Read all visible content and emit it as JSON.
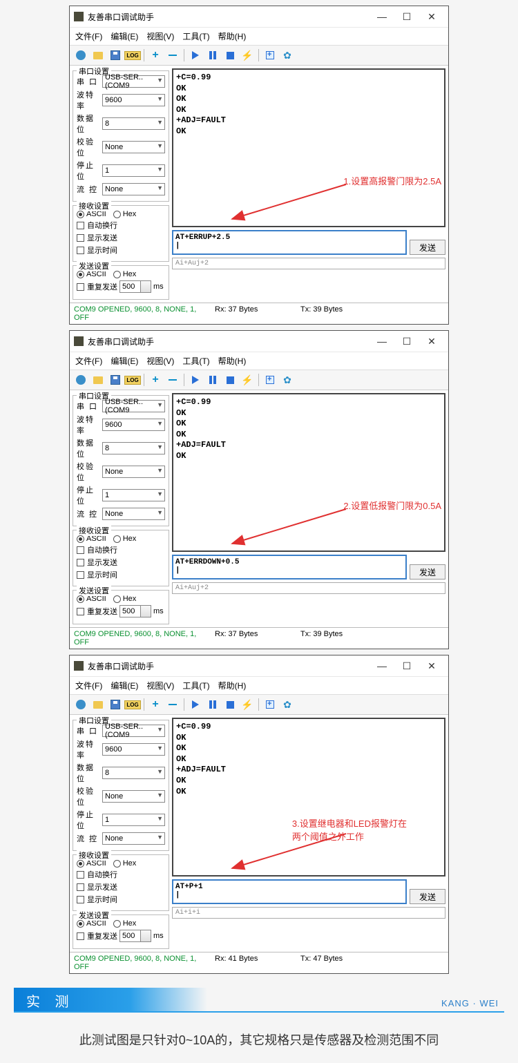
{
  "windows": [
    {
      "title": "友善串口调试助手",
      "menu": [
        "文件(F)",
        "编辑(E)",
        "视图(V)",
        "工具(T)",
        "帮助(H)"
      ],
      "serial": {
        "group": "串口设置",
        "port_label": "串  口",
        "port": "USB-SER..(COM9",
        "baud_label": "波特率",
        "baud": "9600",
        "data_label": "数据位",
        "data": "8",
        "parity_label": "校验位",
        "parity": "None",
        "stop_label": "停止位",
        "stop": "1",
        "flow_label": "流  控",
        "flow": "None"
      },
      "rx_settings": {
        "group": "接收设置",
        "ascii": "ASCII",
        "hex": "Hex",
        "auto_wrap": "自动换行",
        "show_send": "显示发送",
        "show_time": "显示时间"
      },
      "tx_settings": {
        "group": "发送设置",
        "ascii": "ASCII",
        "hex": "Hex",
        "repeat": "重复发送",
        "interval": "500",
        "unit": "ms"
      },
      "rx_text": "+C=0.99\nOK\nOK\nOK\n+ADJ=FAULT\nOK",
      "tx_text": "AT+ERRUP+2.5\n|",
      "hist": "Ai+Auj+2",
      "send_label": "发送",
      "status": {
        "left": "COM9 OPENED, 9600, 8, NONE, 1, OFF",
        "rx": "Rx: 37 Bytes",
        "tx": "Tx: 39 Bytes"
      },
      "annotation": "1.设置高报警门限为2.5A"
    },
    {
      "title": "友善串口调试助手",
      "menu": [
        "文件(F)",
        "编辑(E)",
        "视图(V)",
        "工具(T)",
        "帮助(H)"
      ],
      "serial": {
        "group": "串口设置",
        "port_label": "串  口",
        "port": "USB-SER..(COM9",
        "baud_label": "波特率",
        "baud": "9600",
        "data_label": "数据位",
        "data": "8",
        "parity_label": "校验位",
        "parity": "None",
        "stop_label": "停止位",
        "stop": "1",
        "flow_label": "流  控",
        "flow": "None"
      },
      "rx_settings": {
        "group": "接收设置",
        "ascii": "ASCII",
        "hex": "Hex",
        "auto_wrap": "自动换行",
        "show_send": "显示发送",
        "show_time": "显示时间"
      },
      "tx_settings": {
        "group": "发送设置",
        "ascii": "ASCII",
        "hex": "Hex",
        "repeat": "重复发送",
        "interval": "500",
        "unit": "ms"
      },
      "rx_text": "+C=0.99\nOK\nOK\nOK\n+ADJ=FAULT\nOK",
      "tx_text": "AT+ERRDOWN+0.5\n|",
      "hist": "Ai+Auj+2",
      "send_label": "发送",
      "status": {
        "left": "COM9 OPENED, 9600, 8, NONE, 1, OFF",
        "rx": "Rx: 37 Bytes",
        "tx": "Tx: 39 Bytes"
      },
      "annotation": "2.设置低报警门限为0.5A"
    },
    {
      "title": "友善串口调试助手",
      "menu": [
        "文件(F)",
        "编辑(E)",
        "视图(V)",
        "工具(T)",
        "帮助(H)"
      ],
      "serial": {
        "group": "串口设置",
        "port_label": "串  口",
        "port": "USB-SER..(COM9",
        "baud_label": "波特率",
        "baud": "9600",
        "data_label": "数据位",
        "data": "8",
        "parity_label": "校验位",
        "parity": "None",
        "stop_label": "停止位",
        "stop": "1",
        "flow_label": "流  控",
        "flow": "None"
      },
      "rx_settings": {
        "group": "接收设置",
        "ascii": "ASCII",
        "hex": "Hex",
        "auto_wrap": "自动换行",
        "show_send": "显示发送",
        "show_time": "显示时间"
      },
      "tx_settings": {
        "group": "发送设置",
        "ascii": "ASCII",
        "hex": "Hex",
        "repeat": "重复发送",
        "interval": "500",
        "unit": "ms"
      },
      "rx_text": "+C=0.99\nOK\nOK\nOK\n+ADJ=FAULT\nOK\nOK",
      "tx_text": "AT+P+1\n|",
      "hist": "Ai+i+i",
      "send_label": "发送",
      "status": {
        "left": "COM9 OPENED, 9600, 8, NONE, 1, OFF",
        "rx": "Rx: 41 Bytes",
        "tx": "Tx: 47 Bytes"
      },
      "annotation": "3.设置继电器和LED报警灯在\n两个阈值之外工作"
    }
  ],
  "section": {
    "label": "实 测",
    "brand": "KANG · WEI"
  },
  "caption": "此测试图是只针对0~10A的，其它规格只是传感器及检测范围不同"
}
